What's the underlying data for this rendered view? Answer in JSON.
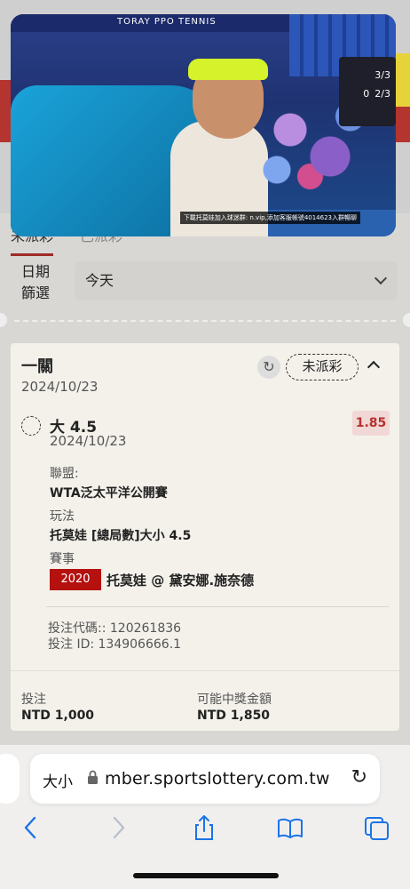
{
  "tabs": {
    "active_label": "未派彩",
    "other_label": "已派彩"
  },
  "video": {
    "banner_text": "TORAY PPO TENNIS",
    "caption": "下載托莫娃加入球迷群: n.vip,添加客服帳號4014623入群暢聊",
    "score_row1": "3/3",
    "score_row2_left": "0",
    "score_row2_right": "2/3"
  },
  "filter": {
    "label": "日期篩選",
    "value": "今天"
  },
  "ticket": {
    "title": "一關",
    "date": "2024/10/23",
    "status": "未派彩",
    "bet": {
      "pick": "大 4.5",
      "date": "2024/10/23",
      "odds": "1.85",
      "league_label": "聯盟:",
      "league": "WTA泛太平洋公開賽",
      "play_label": "玩法",
      "play": "托莫娃 [總局數]大小 4.5",
      "event_label": "賽事",
      "event_badge": "2020",
      "event": "托莫娃 @ 黛安娜.施奈德"
    },
    "code_line": "投注代碼:: 120261836",
    "id_line": "投注 ID: 134906666.1",
    "stake_label": "投注",
    "stake": "NTD 1,000",
    "payout_label": "可能中獎金額",
    "payout": "NTD 1,850"
  },
  "browser": {
    "text_size": "大小",
    "url": "mber.sportslottery.com.tw"
  },
  "colors": {
    "accent_red": "#b4110f",
    "odds_bg": "#f1d8d6",
    "card_bg": "#f3f1ea"
  }
}
